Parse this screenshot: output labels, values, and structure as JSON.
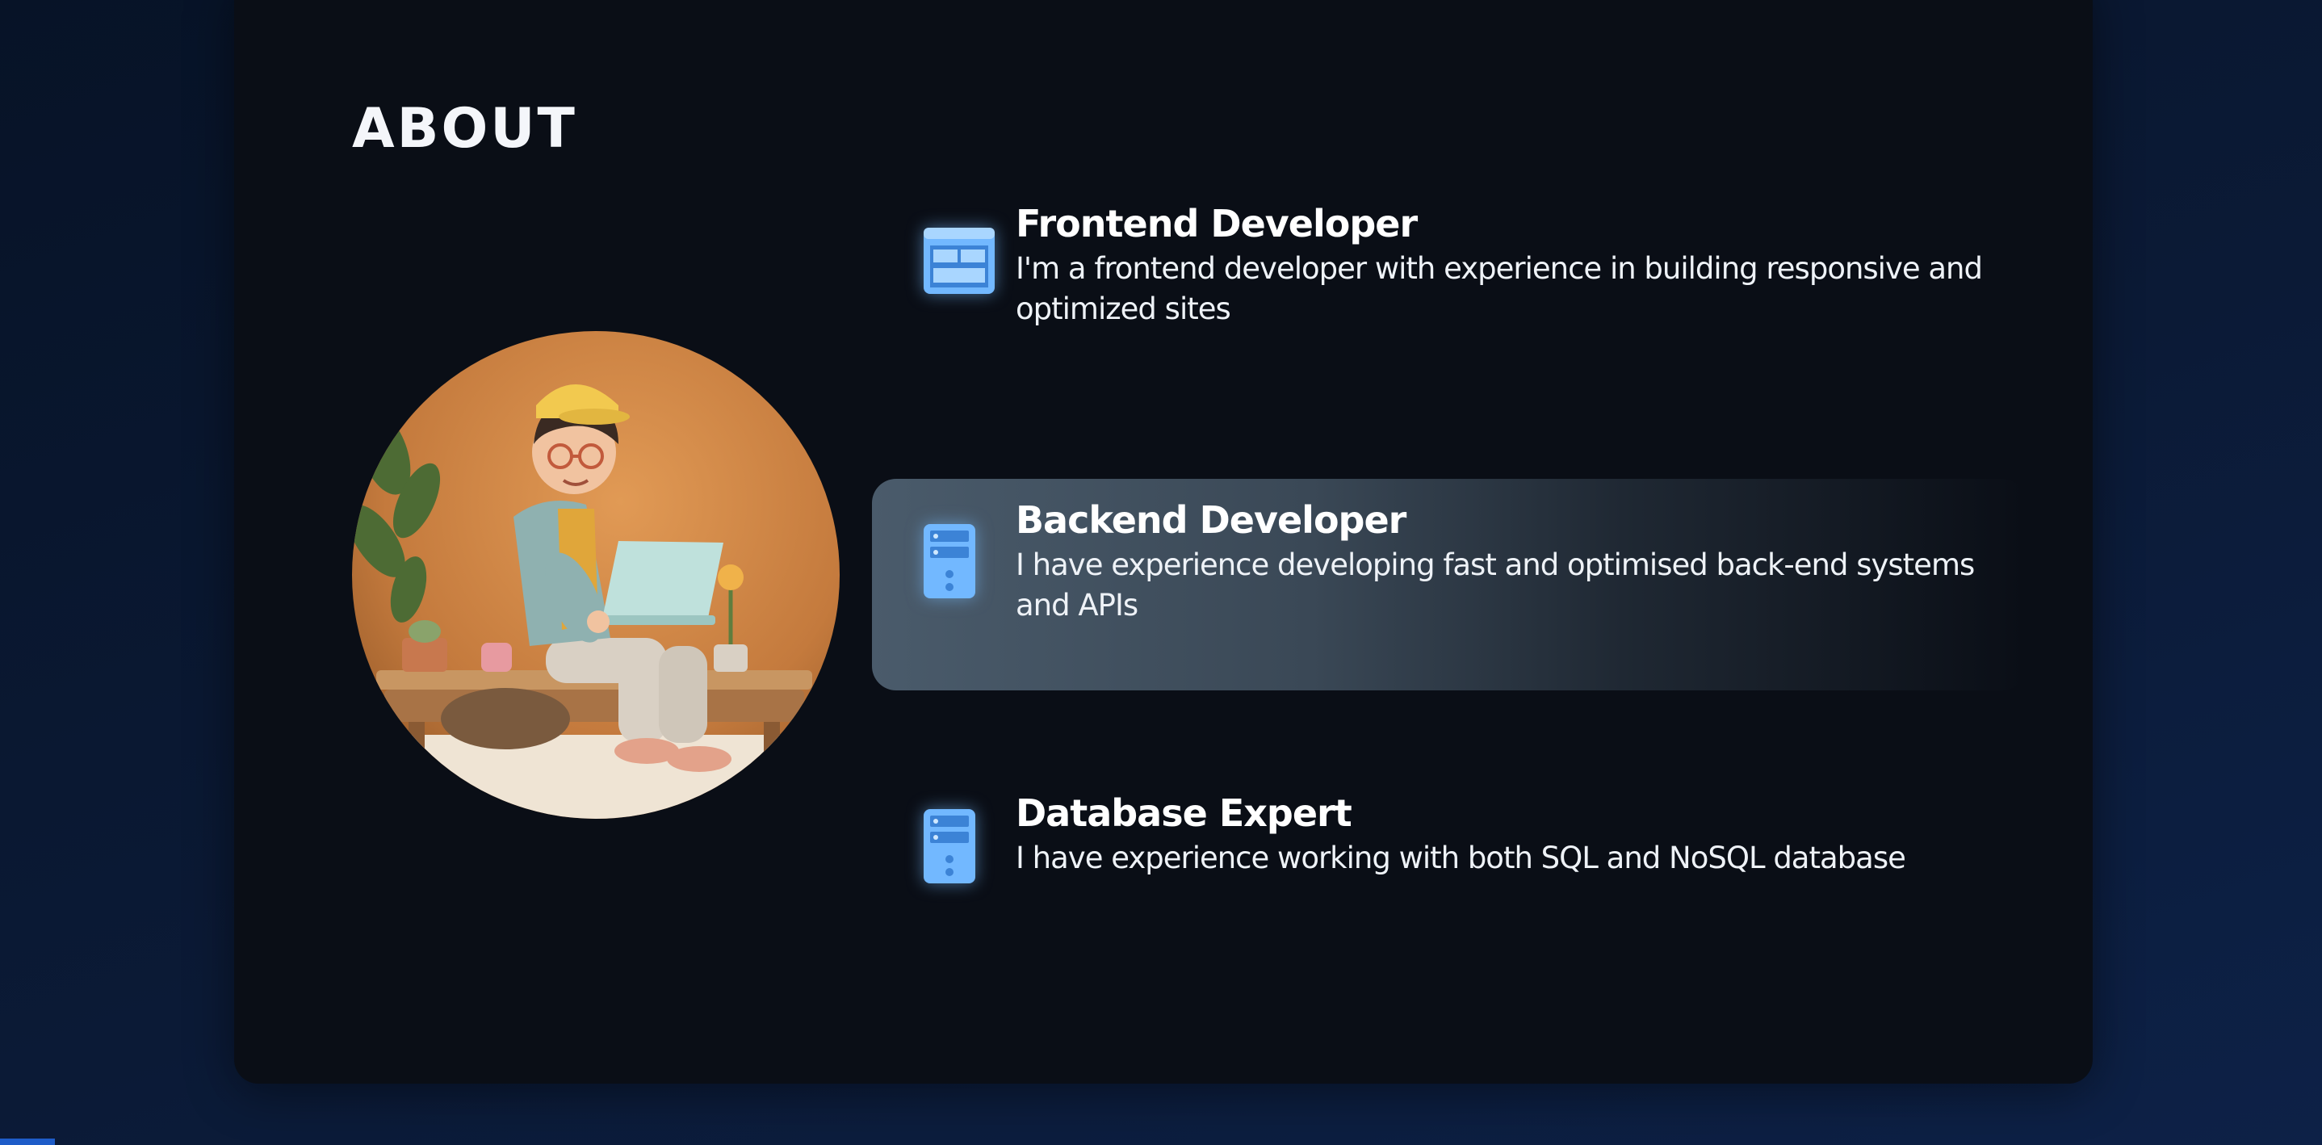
{
  "about": {
    "title": "ABOUT"
  },
  "avatar": {
    "description_icon": "avatar-illustration"
  },
  "skills": [
    {
      "icon": "ui-layout-icon",
      "title": "Frontend Developer",
      "description": "I'm a frontend developer with experience in building responsive and optimized sites"
    },
    {
      "icon": "server-icon",
      "title": "Backend Developer",
      "description": "I have experience developing fast and optimised back-end systems and APIs"
    },
    {
      "icon": "database-icon",
      "title": "Database Expert",
      "description": "I have experience working with both SQL and NoSQL database"
    }
  ],
  "colors": {
    "page_background": "#0b1a36",
    "card_background": "#0a0e16",
    "highlight_background": "#4a5b6b",
    "icon_accent": "#7ec3ff",
    "text": "#ffffff"
  }
}
